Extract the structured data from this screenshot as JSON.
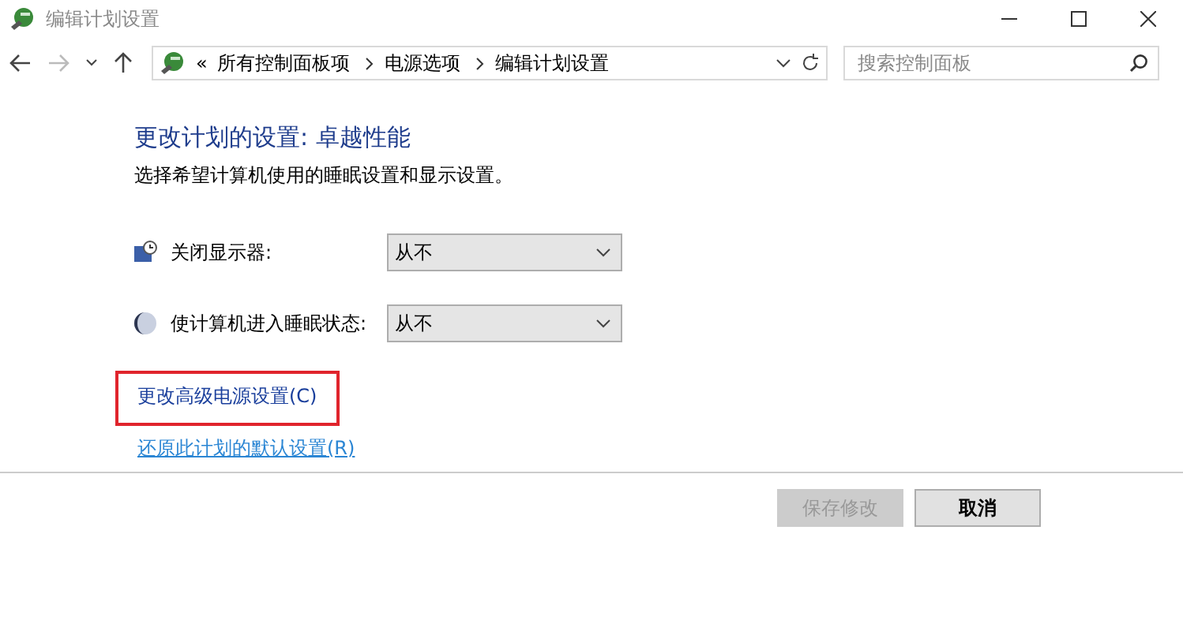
{
  "window": {
    "title": "编辑计划设置"
  },
  "address_bar": {
    "overflow": "«",
    "crumbs": [
      "所有控制面板项",
      "电源选项",
      "编辑计划设置"
    ]
  },
  "search": {
    "placeholder": "搜索控制面板"
  },
  "nav": {
    "back_disabled": false,
    "forward_disabled": true
  },
  "heading": "更改计划的设置: 卓越性能",
  "description": "选择希望计算机使用的睡眠设置和显示设置。",
  "settings": [
    {
      "kind": "display",
      "label": "关闭显示器:",
      "value": "从不"
    },
    {
      "kind": "sleep",
      "label": "使计算机进入睡眠状态:",
      "value": "从不"
    }
  ],
  "links": [
    {
      "text": "更改高级电源设置(C)",
      "underlined": false,
      "highlighted": true
    },
    {
      "text": "还原此计划的默认设置(R)",
      "underlined": true,
      "highlighted": false
    }
  ],
  "buttons": [
    {
      "label": "保存修改",
      "disabled": true
    },
    {
      "label": "取消",
      "disabled": false
    }
  ]
}
